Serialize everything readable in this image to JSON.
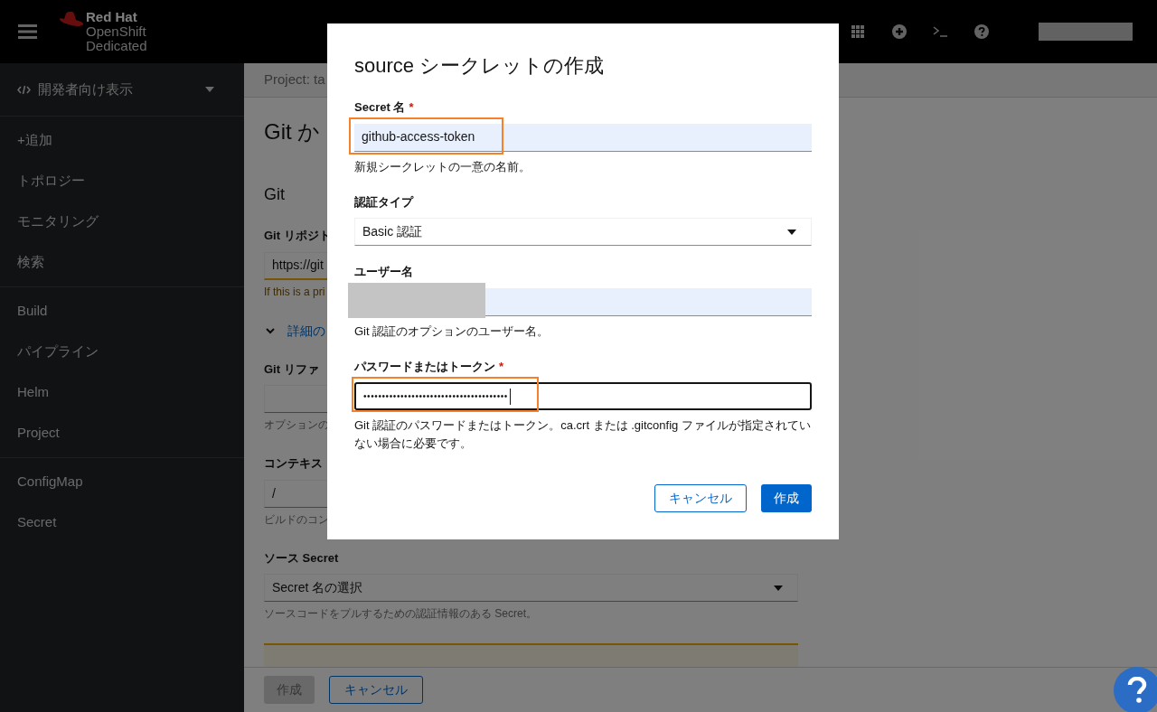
{
  "header": {
    "brand": [
      "Red Hat",
      "OpenShift",
      "Dedicated"
    ],
    "user_redacted": true
  },
  "sidebar": {
    "perspective": "開発者向け表示",
    "sections": [
      {
        "items": [
          {
            "label": "+追加",
            "selected": false
          },
          {
            "label": "トポロジー",
            "selected": false
          },
          {
            "label": "モニタリング",
            "selected": false
          },
          {
            "label": "検索",
            "selected": false
          }
        ]
      },
      {
        "items": [
          {
            "label": "Build",
            "selected": false
          },
          {
            "label": "パイプライン",
            "selected": false
          },
          {
            "label": "Helm",
            "selected": false
          },
          {
            "label": "Project",
            "selected": false
          }
        ]
      },
      {
        "items": [
          {
            "label": "ConfigMap",
            "selected": false
          },
          {
            "label": "Secret",
            "selected": false
          }
        ]
      }
    ]
  },
  "page": {
    "project": "Project: ta",
    "title": "Git か",
    "section": "Git",
    "fields": [
      {
        "kind": "text",
        "label": "Git リポジト",
        "value": "https://git",
        "helper": "If this is a pri",
        "warning": true
      },
      {
        "kind": "expander",
        "label": "詳細の",
        "expanded": true
      },
      {
        "kind": "text",
        "label": "Git リファ",
        "helper": "オプションの",
        "warning": false
      },
      {
        "kind": "text",
        "label": "コンテキス",
        "value": "/",
        "helper": "ビルドのコン",
        "warning": false
      },
      {
        "kind": "select",
        "label": "ソース Secret",
        "value": "Secret 名の選択",
        "helper": "ソースコードをプルするための認証情報のある Secret。"
      },
      {
        "kind": "alert"
      }
    ],
    "footer_buttons": [
      {
        "label": "作成",
        "disabled": true
      },
      {
        "label": "キャンセル",
        "disabled": false
      }
    ]
  },
  "modal": {
    "title": "source シークレットの作成",
    "fields": [
      {
        "kind": "text",
        "label": "Secret 名",
        "required_mark": "*",
        "value": "github-access-token",
        "autofilled": true,
        "highlighted": true,
        "helper": "新規シークレットの一意の名前。"
      },
      {
        "kind": "select",
        "label": "認証タイプ",
        "value": "Basic 認証"
      },
      {
        "kind": "text",
        "label": "ユーザー名",
        "redacted": true,
        "autofilled": true,
        "helper": "Git 認証のオプションのユーザー名。"
      },
      {
        "kind": "password",
        "label": "パスワードまたはトークン",
        "required_mark": "*",
        "value": "•••••••••••••••••••••••••••••••••••••••",
        "focused": true,
        "highlighted": true,
        "helper": "Git 認証のパスワードまたはトークン。ca.crt または .gitconfig ファイルが指定されていない場合に必要です。"
      }
    ],
    "buttons": [
      {
        "label": "キャンセル",
        "kind": "secondary"
      },
      {
        "label": "作成",
        "kind": "primary"
      }
    ]
  }
}
